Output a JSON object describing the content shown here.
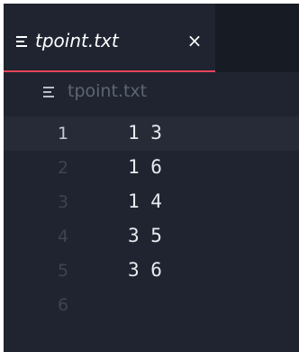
{
  "tab": {
    "label": "tpoint.txt",
    "close_glyph": "×",
    "icon": "text-file-icon"
  },
  "breadcrumb": {
    "label": "tpoint.txt",
    "icon": "text-file-icon"
  },
  "editor": {
    "current_line": 1,
    "lines": [
      {
        "number": "1",
        "text": "1 3"
      },
      {
        "number": "2",
        "text": "1 6"
      },
      {
        "number": "3",
        "text": "1 4"
      },
      {
        "number": "4",
        "text": "3 5"
      },
      {
        "number": "5",
        "text": "3 6"
      },
      {
        "number": "6",
        "text": ""
      }
    ]
  },
  "colors": {
    "editor_background": "#1f2430",
    "tab_accent": "#e6455a",
    "text": "#e8eaee"
  }
}
